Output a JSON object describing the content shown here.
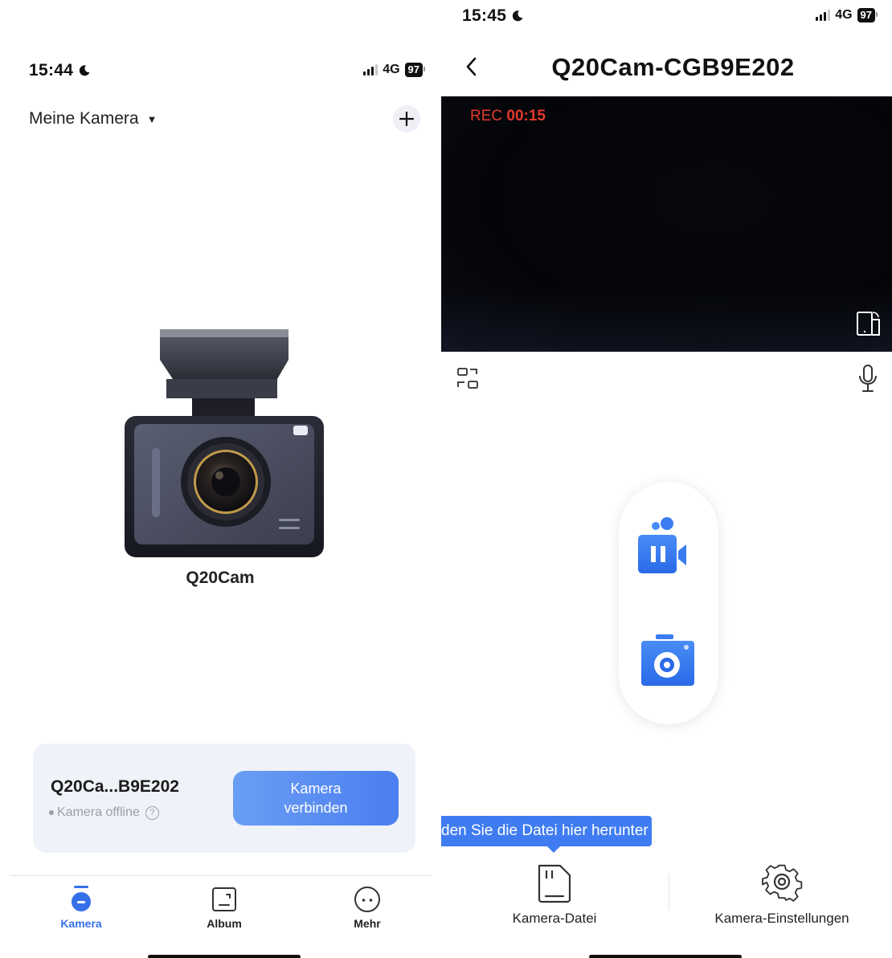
{
  "left": {
    "status": {
      "time": "15:44",
      "network": "4G",
      "battery": "97"
    },
    "camera_selector": "Meine Kamera",
    "camera_name": "Q20Cam",
    "device_card": {
      "name": "Q20Ca...B9E202",
      "status": "Kamera offline",
      "connect_button": "Kamera verbinden"
    },
    "tabs": [
      {
        "label": "Kamera",
        "icon": "camera-tab-icon",
        "active": true
      },
      {
        "label": "Album",
        "icon": "album-icon",
        "active": false
      },
      {
        "label": "Mehr",
        "icon": "more-icon",
        "active": false
      }
    ]
  },
  "right": {
    "status": {
      "time": "15:45",
      "network": "4G",
      "battery": "97"
    },
    "title": "Q20Cam-CGB9E202",
    "rec_label": "REC",
    "rec_time": "00:15",
    "tooltip": "den Sie die Datei hier herunter",
    "bottom": {
      "files_label": "Kamera-Datei",
      "settings_label": "Kamera-Einstellungen"
    }
  },
  "colors": {
    "accent": "#3570e8",
    "rec_red": "#e33a2b",
    "card_bg": "#eff2f8",
    "tooltip_bg": "#3f7cf1"
  }
}
